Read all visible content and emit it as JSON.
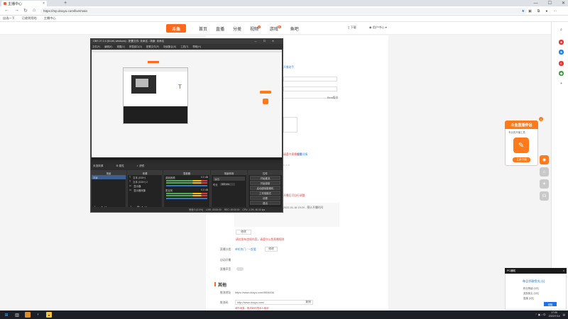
{
  "browser": {
    "tab_title": "主播中心",
    "url": "https://mp.douyu.com/live/main",
    "bookmarks": [
      "自选一下",
      "已收到您的",
      "主播中心"
    ]
  },
  "site": {
    "logo": "斗鱼",
    "nav": [
      {
        "label": "首页",
        "badge": ""
      },
      {
        "label": "直播",
        "badge": ""
      },
      {
        "label": "分类",
        "badge": ""
      },
      {
        "label": "视频",
        "badge": "2"
      },
      {
        "label": "游戏",
        "badge": "新"
      },
      {
        "label": "鱼吧",
        "badge": ""
      }
    ],
    "download": "下载",
    "user": "用户中心"
  },
  "content": {
    "link_top": "开播助手",
    "pagination_label": "Beta版本",
    "red_note1": "请遵守直播规则",
    "red_note2": "开播后可自行调整",
    "blue_link": "查看详情",
    "time_text": "2022-01-18 19:20 - 预计开播时间",
    "btn_modify": "修改",
    "warning": "请勿发布违规内容，请遵守斗鱼直播规则",
    "room_label": "直播分类",
    "room_value": "单机热门 / 一起看",
    "room_btn": "修改",
    "auto_label": "自动开播",
    "live_label": "直播声音",
    "section_other": "其他",
    "addr_label": "推流地址",
    "addr_value": "https://www.douyu.com/9854836",
    "push_label": "推流码",
    "push_value": "http://www.douyu.com/",
    "push_btn": "复制",
    "push_warn": "请勿泄露，推流码仅限本人使用"
  },
  "promo": {
    "title": "斗鱼直播伴侣",
    "subtitle": "专业的开播工具",
    "cta": "立即下载"
  },
  "notification": {
    "head": "PC通知",
    "title": "每日领取鱼丸 (1)",
    "line1": "粉丝等级 (5天)",
    "line2": "奖励鱼丸 (5天)",
    "line3": "直播 (5天)",
    "action": "领取"
  },
  "obs": {
    "title": "OBS 27.2.4 (64-bit, windows) - 配置文件: 未命名 - 场景: 未命名",
    "menu": [
      "文件(F)",
      "编辑(E)",
      "视图(V)",
      "停靠窗口(D)",
      "配置文件(P)",
      "场景集合(S)",
      "工具(T)",
      "帮助(H)"
    ],
    "toolbar": [
      "未选择源",
      "属性",
      "滤镜"
    ],
    "docks": {
      "scenes": {
        "title": "场景",
        "items": [
          "场景"
        ]
      },
      "sources": {
        "title": "来源",
        "items": [
          "文本 (GDI+)",
          "文本 (GDI+) 2",
          "显示器",
          "显示器采集"
        ]
      },
      "mixer": {
        "title": "混音器",
        "channels": [
          {
            "name": "桌面音频",
            "db": "0.0 dB"
          },
          {
            "name": "麦克风",
            "db": "0.0 dB"
          }
        ]
      },
      "transitions": {
        "title": "场景转场",
        "type": "淡出",
        "duration_label": "时长",
        "duration": "300 ms"
      },
      "controls": {
        "title": "控件",
        "buttons": [
          "开始推流",
          "开始录制",
          "启动虚拟摄像机",
          "工作室模式",
          "设置",
          "退出"
        ]
      }
    },
    "status": [
      "丢帧 0 (0.0%)",
      "LIVE: 00:00:00",
      "REC: 00:00:00",
      "CPU: 1.3%, 60.00 fps"
    ]
  },
  "taskbar": {
    "time": "17:00",
    "date": "2022/7/14"
  },
  "colors": {
    "brand": "#ff6a1a",
    "link": "#3c8ce7",
    "warn": "#e04242"
  }
}
